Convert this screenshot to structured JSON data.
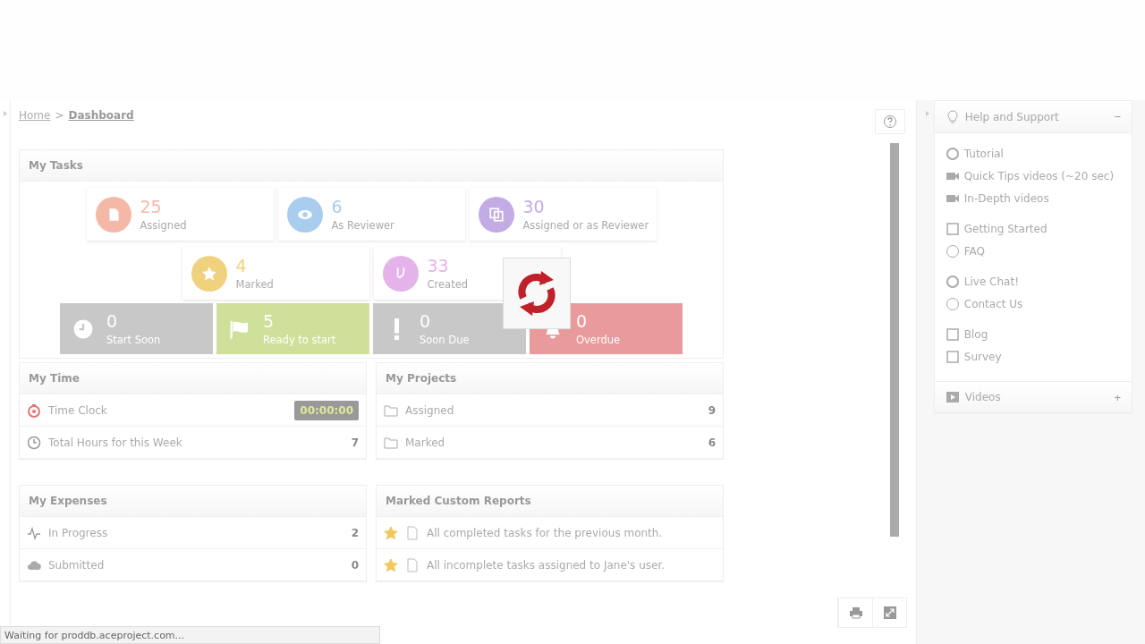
{
  "breadcrumb_separator": ">",
  "breadcrumb": [
    {
      "label": "Home",
      "current": false
    },
    {
      "label": "Dashboard",
      "current": true
    }
  ],
  "my_tasks": {
    "title": "My Tasks",
    "cards": [
      {
        "count": "25",
        "label": "Assigned",
        "color": "#f5b8a6"
      },
      {
        "count": "6",
        "label": "As Reviewer",
        "color": "#a9cdee"
      },
      {
        "count": "30",
        "label": "Assigned or as Reviewer",
        "color": "#c3abe6"
      },
      {
        "count": "4",
        "label": "Marked",
        "color": "#f0d27e"
      },
      {
        "count": "33",
        "label": "Created",
        "color": "#e4b3ea"
      }
    ],
    "tiles": [
      {
        "count": "0",
        "label": "Start Soon",
        "color": "#c8c8c8"
      },
      {
        "count": "5",
        "label": "Ready to start",
        "color": "#cfe09a"
      },
      {
        "count": "0",
        "label": "Soon Due",
        "color": "#c8c8c8"
      },
      {
        "count": "0",
        "label": "Overdue",
        "color": "#e89a9c"
      }
    ]
  },
  "my_time": {
    "title": "My Time",
    "rows": [
      {
        "label": "Time Clock",
        "value": "00:00:00",
        "kind": "timer"
      },
      {
        "label": "Total Hours for this Week",
        "value": "7",
        "kind": "plain"
      }
    ]
  },
  "my_projects": {
    "title": "My Projects",
    "rows": [
      {
        "label": "Assigned",
        "value": "9",
        "kind": "plain"
      },
      {
        "label": "Marked",
        "value": "6",
        "kind": "plain"
      }
    ]
  },
  "my_expenses": {
    "title": "My Expenses",
    "rows": [
      {
        "label": "In Progress",
        "value": "2",
        "kind": "plain"
      },
      {
        "label": "Submitted",
        "value": "0",
        "kind": "plain"
      }
    ]
  },
  "reports": {
    "title": "Marked Custom Reports",
    "items": [
      {
        "text": "All completed tasks for the previous month.",
        "marked": true
      },
      {
        "text": "All incomplete tasks assigned to Jane's user.",
        "marked": true
      }
    ]
  },
  "help": {
    "title": "Help and Support",
    "toggle": "−",
    "groups": [
      [
        "Tutorial",
        "Quick Tips videos (~20 sec)",
        "In-Depth videos"
      ],
      [
        "Getting Started",
        "FAQ"
      ],
      [
        "Live Chat!",
        "Contact Us"
      ],
      [
        "Blog",
        "Survey"
      ]
    ]
  },
  "videos": {
    "title": "Videos",
    "toggle": "+"
  },
  "status_bar": "Waiting for proddb.aceproject.com..."
}
